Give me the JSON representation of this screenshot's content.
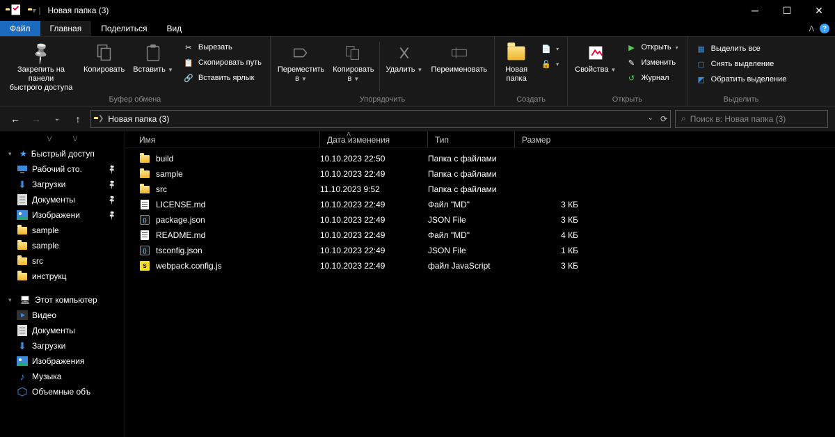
{
  "title": "Новая папка (3)",
  "menu": {
    "file": "Файл",
    "home": "Главная",
    "share": "Поделиться",
    "view": "Вид"
  },
  "ribbon": {
    "clipboard": {
      "pin": "Закрепить на панели\nбыстрого доступа",
      "copy": "Копировать",
      "paste": "Вставить",
      "cut": "Вырезать",
      "copypath": "Скопировать путь",
      "pasteshortcut": "Вставить ярлык",
      "label": "Буфер обмена"
    },
    "organize": {
      "moveto": "Переместить\nв",
      "copyto": "Копировать\nв",
      "delete": "Удалить",
      "rename": "Переименовать",
      "label": "Упорядочить"
    },
    "new": {
      "newfolder": "Новая\nпапка",
      "label": "Создать"
    },
    "open": {
      "properties": "Свойства",
      "open": "Открыть",
      "edit": "Изменить",
      "history": "Журнал",
      "label": "Открыть"
    },
    "select": {
      "selectall": "Выделить все",
      "selectnone": "Снять выделение",
      "invert": "Обратить выделение",
      "label": "Выделить"
    }
  },
  "breadcrumb": "Новая папка (3)",
  "search_placeholder": "Поиск в: Новая папка (3)",
  "columns": {
    "name": "Имя",
    "date": "Дата изменения",
    "type": "Тип",
    "size": "Размер"
  },
  "sidebar": {
    "quick": "Быстрый доступ",
    "items1": [
      {
        "label": "Рабочий сто.",
        "pinned": true,
        "icon": "desktop"
      },
      {
        "label": "Загрузки",
        "pinned": true,
        "icon": "downloads"
      },
      {
        "label": "Документы",
        "pinned": true,
        "icon": "documents"
      },
      {
        "label": "Изображени",
        "pinned": true,
        "icon": "pictures"
      },
      {
        "label": "sample",
        "pinned": false,
        "icon": "folder"
      },
      {
        "label": "sample",
        "pinned": false,
        "icon": "folder"
      },
      {
        "label": "src",
        "pinned": false,
        "icon": "folder"
      },
      {
        "label": "инструкц",
        "pinned": false,
        "icon": "folder"
      }
    ],
    "thispc": "Этот компьютер",
    "items2": [
      {
        "label": "Видео",
        "icon": "videos"
      },
      {
        "label": "Документы",
        "icon": "documents"
      },
      {
        "label": "Загрузки",
        "icon": "downloads"
      },
      {
        "label": "Изображения",
        "icon": "pictures"
      },
      {
        "label": "Музыка",
        "icon": "music"
      },
      {
        "label": "Объемные объ",
        "icon": "3d"
      }
    ]
  },
  "files": [
    {
      "name": "build",
      "date": "10.10.2023 22:50",
      "type": "Папка с файлами",
      "size": "",
      "kind": "folder"
    },
    {
      "name": "sample",
      "date": "10.10.2023 22:49",
      "type": "Папка с файлами",
      "size": "",
      "kind": "folder"
    },
    {
      "name": "src",
      "date": "11.10.2023 9:52",
      "type": "Папка с файлами",
      "size": "",
      "kind": "folder"
    },
    {
      "name": "LICENSE.md",
      "date": "10.10.2023 22:49",
      "type": "Файл \"MD\"",
      "size": "3 КБ",
      "kind": "md"
    },
    {
      "name": "package.json",
      "date": "10.10.2023 22:49",
      "type": "JSON File",
      "size": "3 КБ",
      "kind": "json"
    },
    {
      "name": "README.md",
      "date": "10.10.2023 22:49",
      "type": "Файл \"MD\"",
      "size": "4 КБ",
      "kind": "md"
    },
    {
      "name": "tsconfig.json",
      "date": "10.10.2023 22:49",
      "type": "JSON File",
      "size": "1 КБ",
      "kind": "json"
    },
    {
      "name": "webpack.config.js",
      "date": "10.10.2023 22:49",
      "type": "файл JavaScript",
      "size": "3 КБ",
      "kind": "js"
    }
  ]
}
